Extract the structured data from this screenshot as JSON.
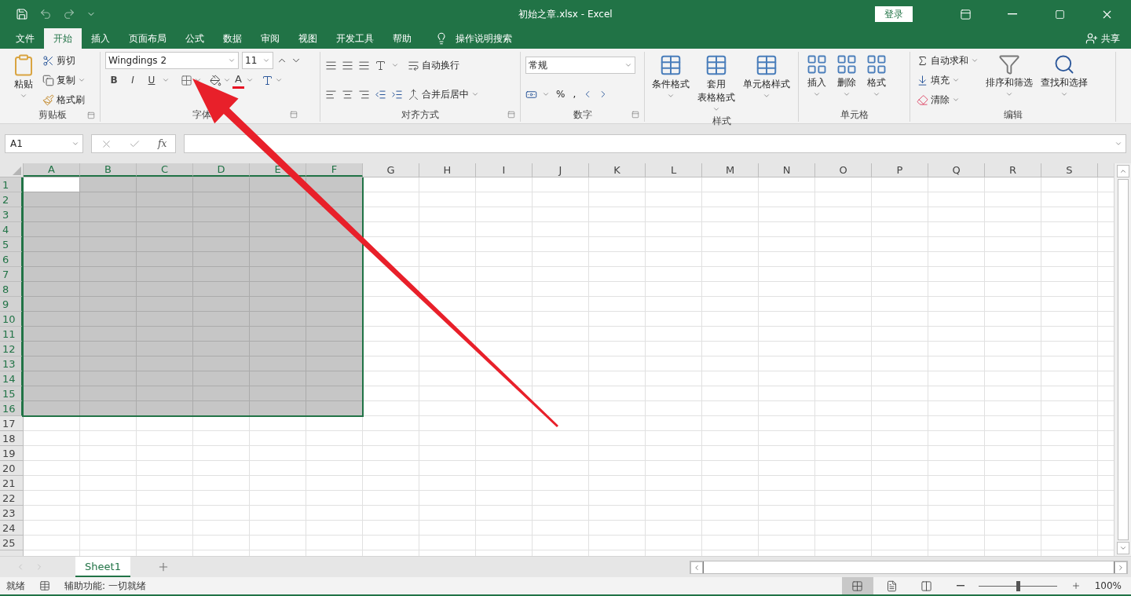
{
  "title_bar": {
    "file_title": "初始之章.xlsx  -  Excel",
    "login": "登录"
  },
  "menu_tabs": [
    {
      "label": "文件",
      "selected": false
    },
    {
      "label": "开始",
      "selected": true
    },
    {
      "label": "插入",
      "selected": false
    },
    {
      "label": "页面布局",
      "selected": false
    },
    {
      "label": "公式",
      "selected": false
    },
    {
      "label": "数据",
      "selected": false
    },
    {
      "label": "审阅",
      "selected": false
    },
    {
      "label": "视图",
      "selected": false
    },
    {
      "label": "开发工具",
      "selected": false
    },
    {
      "label": "帮助",
      "selected": false
    }
  ],
  "tell_me": "操作说明搜索",
  "share": "共享",
  "clipboard": {
    "label": "剪贴板",
    "paste": "粘贴",
    "cut": "剪切",
    "copy": "复制",
    "format_painter": "格式刷"
  },
  "font": {
    "label": "字体",
    "name": "Wingdings 2",
    "size": "11",
    "bold": "B",
    "italic": "I",
    "underline": "U",
    "color_letter": "A"
  },
  "alignment": {
    "label": "对齐方式",
    "wrap": "自动换行",
    "merge": "合并后居中"
  },
  "number": {
    "label": "数字",
    "format": "常规",
    "percent": "%",
    "comma": ","
  },
  "styles": {
    "label": "样式",
    "buttons": [
      {
        "lines": [
          "条件格式"
        ]
      },
      {
        "lines": [
          "套用",
          "表格格式"
        ]
      },
      {
        "lines": [
          "单元格样式"
        ]
      }
    ]
  },
  "cells": {
    "label": "单元格",
    "buttons": [
      "插入",
      "删除",
      "格式"
    ]
  },
  "editing": {
    "label": "编辑",
    "autosum": "自动求和",
    "fill": "填充",
    "clear": "清除",
    "sort": "排序和筛选",
    "find": "查找和选择"
  },
  "formula_bar": {
    "name_box": "A1",
    "fx": "fx"
  },
  "grid": {
    "columns": [
      {
        "label": "A",
        "selected": true,
        "active": true
      },
      {
        "label": "B",
        "selected": true,
        "active": false
      },
      {
        "label": "C",
        "selected": true,
        "active": false
      },
      {
        "label": "D",
        "selected": true,
        "active": false
      },
      {
        "label": "E",
        "selected": true,
        "active": false
      },
      {
        "label": "F",
        "selected": true,
        "active": false
      },
      {
        "label": "G",
        "selected": false,
        "active": false
      },
      {
        "label": "H",
        "selected": false,
        "active": false
      },
      {
        "label": "I",
        "selected": false,
        "active": false
      },
      {
        "label": "J",
        "selected": false,
        "active": false
      },
      {
        "label": "K",
        "selected": false,
        "active": false
      },
      {
        "label": "L",
        "selected": false,
        "active": false
      },
      {
        "label": "M",
        "selected": false,
        "active": false
      },
      {
        "label": "N",
        "selected": false,
        "active": false
      },
      {
        "label": "O",
        "selected": false,
        "active": false
      },
      {
        "label": "P",
        "selected": false,
        "active": false
      },
      {
        "label": "Q",
        "selected": false,
        "active": false
      },
      {
        "label": "R",
        "selected": false,
        "active": false
      },
      {
        "label": "S",
        "selected": false,
        "active": false
      }
    ],
    "rows": [
      {
        "label": "1",
        "selected": true,
        "active": true
      },
      {
        "label": "2",
        "selected": true,
        "active": false
      },
      {
        "label": "3",
        "selected": true,
        "active": false
      },
      {
        "label": "4",
        "selected": true,
        "active": false
      },
      {
        "label": "5",
        "selected": true,
        "active": false
      },
      {
        "label": "6",
        "selected": true,
        "active": false
      },
      {
        "label": "7",
        "selected": true,
        "active": false
      },
      {
        "label": "8",
        "selected": true,
        "active": false
      },
      {
        "label": "9",
        "selected": true,
        "active": false
      },
      {
        "label": "10",
        "selected": true,
        "active": false
      },
      {
        "label": "11",
        "selected": true,
        "active": false
      },
      {
        "label": "12",
        "selected": true,
        "active": false
      },
      {
        "label": "13",
        "selected": true,
        "active": false
      },
      {
        "label": "14",
        "selected": true,
        "active": false
      },
      {
        "label": "15",
        "selected": true,
        "active": false
      },
      {
        "label": "16",
        "selected": true,
        "active": false
      },
      {
        "label": "17",
        "selected": false,
        "active": false
      },
      {
        "label": "18",
        "selected": false,
        "active": false
      },
      {
        "label": "19",
        "selected": false,
        "active": false
      },
      {
        "label": "20",
        "selected": false,
        "active": false
      },
      {
        "label": "21",
        "selected": false,
        "active": false
      },
      {
        "label": "22",
        "selected": false,
        "active": false
      },
      {
        "label": "23",
        "selected": false,
        "active": false
      },
      {
        "label": "24",
        "selected": false,
        "active": false
      },
      {
        "label": "25",
        "selected": false,
        "active": false
      }
    ]
  },
  "sheet_tabs": [
    {
      "label": "Sheet1",
      "selected": true
    }
  ],
  "status_bar": {
    "ready": "就绪",
    "accessibility": "辅助功能: 一切就绪",
    "views": [
      {
        "kind": "normal",
        "selected": true
      },
      {
        "kind": "page_layout",
        "selected": false
      },
      {
        "kind": "page_break",
        "selected": false
      }
    ],
    "zoom": {
      "level": 0.5,
      "reading": "100%"
    }
  }
}
